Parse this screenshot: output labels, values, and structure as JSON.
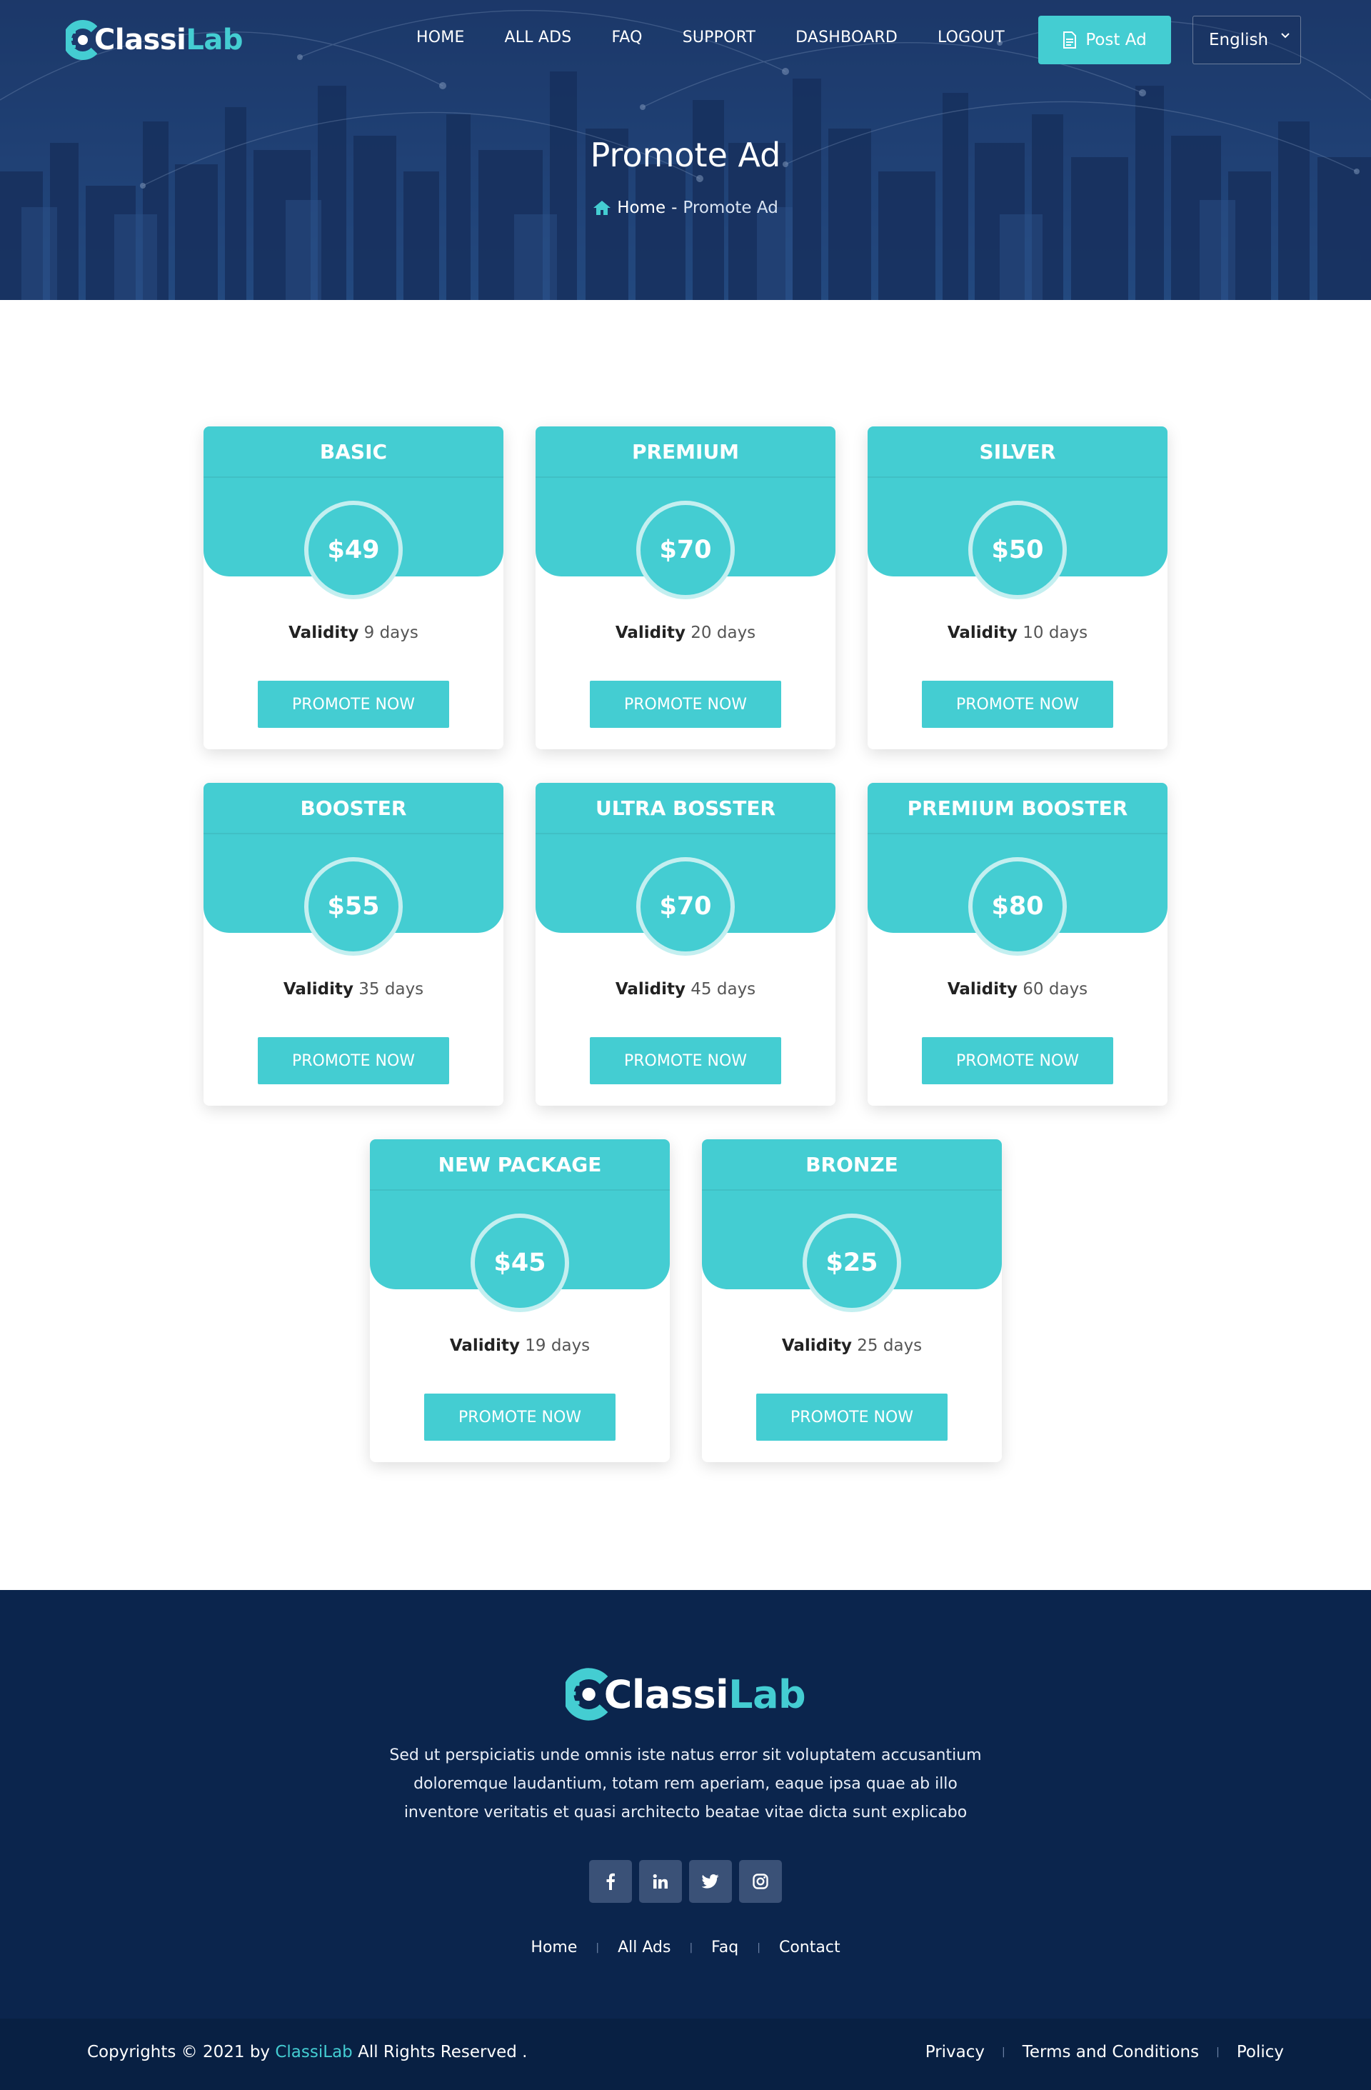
{
  "brand": {
    "name_part1": "Classi",
    "name_part2": "Lab",
    "logo_letter": "C"
  },
  "nav": {
    "items": [
      "HOME",
      "ALL ADS",
      "FAQ",
      "SUPPORT",
      "DASHBOARD",
      "LOGOUT"
    ],
    "post_ad_label": "Post Ad",
    "language": "English"
  },
  "hero": {
    "title": "Promote Ad",
    "breadcrumb_home": "Home",
    "breadcrumb_sep": "-",
    "breadcrumb_current": "Promote Ad"
  },
  "packages": [
    {
      "name": "BASIC",
      "price": "$49",
      "validity_label": "Validity",
      "validity_value": "9 days",
      "button": "PROMOTE NOW"
    },
    {
      "name": "PREMIUM",
      "price": "$70",
      "validity_label": "Validity",
      "validity_value": "20 days",
      "button": "PROMOTE NOW"
    },
    {
      "name": "SILVER",
      "price": "$50",
      "validity_label": "Validity",
      "validity_value": "10 days",
      "button": "PROMOTE NOW"
    },
    {
      "name": "BOOSTER",
      "price": "$55",
      "validity_label": "Validity",
      "validity_value": "35 days",
      "button": "PROMOTE NOW"
    },
    {
      "name": "ULTRA BOSSTER",
      "price": "$70",
      "validity_label": "Validity",
      "validity_value": "45 days",
      "button": "PROMOTE NOW"
    },
    {
      "name": "PREMIUM BOOSTER",
      "price": "$80",
      "validity_label": "Validity",
      "validity_value": "60 days",
      "button": "PROMOTE NOW"
    },
    {
      "name": "NEW PACKAGE",
      "price": "$45",
      "validity_label": "Validity",
      "validity_value": "19 days",
      "button": "PROMOTE NOW"
    },
    {
      "name": "BRONZE",
      "price": "$25",
      "validity_label": "Validity",
      "validity_value": "25 days",
      "button": "PROMOTE NOW"
    }
  ],
  "footer": {
    "about": "Sed ut perspiciatis unde omnis iste natus error sit voluptatem accusantium doloremque laudantium, totam rem aperiam, eaque ipsa quae ab illo inventore veritatis et quasi architecto beatae vitae dicta sunt explicabo",
    "socials": [
      "facebook-icon",
      "linkedin-icon",
      "twitter-icon",
      "instagram-icon"
    ],
    "links": [
      "Home",
      "All Ads",
      "Faq",
      "Contact"
    ],
    "link_separator": "|",
    "copyright_prefix": "Copyrights © 2021 by",
    "copyright_brand": "ClassiLab",
    "copyright_suffix": "All Rights Reserved .",
    "legal_links": [
      "Privacy",
      "Terms and Conditions",
      "Policy"
    ]
  },
  "colors": {
    "accent": "#44cdd2",
    "footer_bg": "#0b254d",
    "bottom_bar_bg": "#082043",
    "hero_bg": "#1d3a6b"
  }
}
